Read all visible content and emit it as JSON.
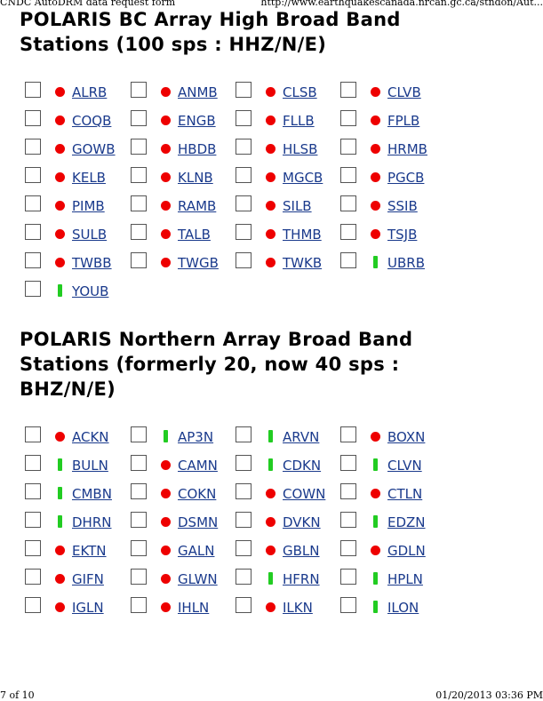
{
  "print_header": {
    "left": "CNDC AutoDRM data request form",
    "right": "http://www.earthquakescanada.nrcan.gc.ca/stndon/Aut..."
  },
  "print_footer": {
    "left": "7 of 10",
    "right": "01/20/2013 03:36 PM"
  },
  "sections": [
    {
      "title_line1": "POLARIS BC Array High Broad Band",
      "title_line2": "Stations (100 sps : HHZ/N/E)",
      "stations": [
        {
          "code": "ALRB",
          "status": "red"
        },
        {
          "code": "ANMB",
          "status": "red"
        },
        {
          "code": "CLSB",
          "status": "red"
        },
        {
          "code": "CLVB",
          "status": "red"
        },
        {
          "code": "COQB",
          "status": "red"
        },
        {
          "code": "ENGB",
          "status": "red"
        },
        {
          "code": "FLLB",
          "status": "red"
        },
        {
          "code": "FPLB",
          "status": "red"
        },
        {
          "code": "GOWB",
          "status": "red"
        },
        {
          "code": "HBDB",
          "status": "red"
        },
        {
          "code": "HLSB",
          "status": "red"
        },
        {
          "code": "HRMB",
          "status": "red"
        },
        {
          "code": "KELB",
          "status": "red"
        },
        {
          "code": "KLNB",
          "status": "red"
        },
        {
          "code": "MGCB",
          "status": "red"
        },
        {
          "code": "PGCB",
          "status": "red"
        },
        {
          "code": "PIMB",
          "status": "red"
        },
        {
          "code": "RAMB",
          "status": "red"
        },
        {
          "code": "SILB",
          "status": "red"
        },
        {
          "code": "SSIB",
          "status": "red"
        },
        {
          "code": "SULB",
          "status": "red"
        },
        {
          "code": "TALB",
          "status": "red"
        },
        {
          "code": "THMB",
          "status": "red"
        },
        {
          "code": "TSJB",
          "status": "red"
        },
        {
          "code": "TWBB",
          "status": "red"
        },
        {
          "code": "TWGB",
          "status": "red"
        },
        {
          "code": "TWKB",
          "status": "red"
        },
        {
          "code": "UBRB",
          "status": "green"
        },
        {
          "code": "YOUB",
          "status": "green"
        }
      ]
    },
    {
      "title_line1": "POLARIS Northern Array Broad Band",
      "title_line2": "Stations (formerly 20, now 40 sps :",
      "title_line3": "BHZ/N/E)",
      "stations": [
        {
          "code": "ACKN",
          "status": "red"
        },
        {
          "code": "AP3N",
          "status": "green"
        },
        {
          "code": "ARVN",
          "status": "green"
        },
        {
          "code": "BOXN",
          "status": "red"
        },
        {
          "code": "BULN",
          "status": "green"
        },
        {
          "code": "CAMN",
          "status": "red"
        },
        {
          "code": "CDKN",
          "status": "green"
        },
        {
          "code": "CLVN",
          "status": "green"
        },
        {
          "code": "CMBN",
          "status": "green"
        },
        {
          "code": "COKN",
          "status": "red"
        },
        {
          "code": "COWN",
          "status": "red"
        },
        {
          "code": "CTLN",
          "status": "red"
        },
        {
          "code": "DHRN",
          "status": "green"
        },
        {
          "code": "DSMN",
          "status": "red"
        },
        {
          "code": "DVKN",
          "status": "red"
        },
        {
          "code": "EDZN",
          "status": "green"
        },
        {
          "code": "EKTN",
          "status": "red"
        },
        {
          "code": "GALN",
          "status": "red"
        },
        {
          "code": "GBLN",
          "status": "red"
        },
        {
          "code": "GDLN",
          "status": "red"
        },
        {
          "code": "GIFN",
          "status": "red"
        },
        {
          "code": "GLWN",
          "status": "red"
        },
        {
          "code": "HFRN",
          "status": "green"
        },
        {
          "code": "HPLN",
          "status": "green"
        },
        {
          "code": "IGLN",
          "status": "red"
        },
        {
          "code": "IHLN",
          "status": "red"
        },
        {
          "code": "ILKN",
          "status": "red"
        },
        {
          "code": "ILON",
          "status": "green"
        }
      ]
    }
  ],
  "colors": {
    "link": "#1a3a8c",
    "status_red": "#ee0000",
    "status_green": "#22cc22"
  },
  "icons": {
    "red": "red-status-dot-icon",
    "green": "green-status-bar-icon"
  }
}
